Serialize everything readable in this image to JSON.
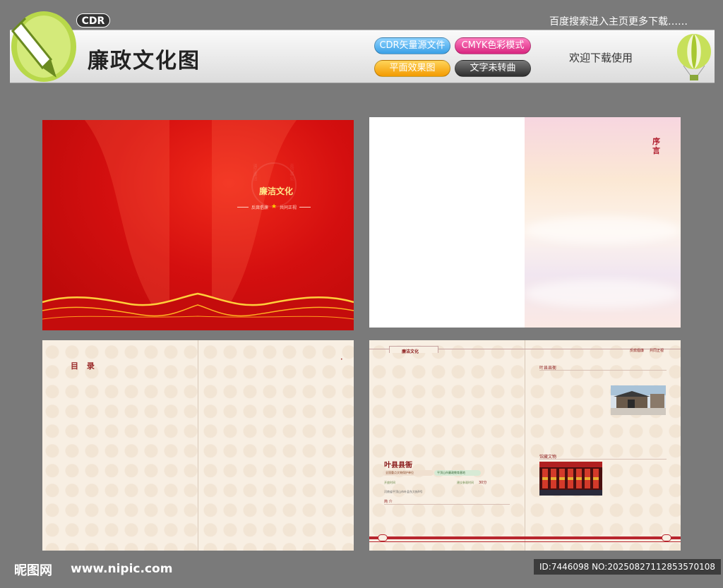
{
  "banner": {
    "cdr_tag": "CDR",
    "top_right": "百度搜索进入主页更多下载……",
    "title": "廉政文化图",
    "pills": {
      "cdr": "CDR矢量源文件",
      "cmyk": "CMYK色彩模式",
      "effect": "平面效果图",
      "text": "文字未转曲"
    },
    "welcome": "欢迎下载使用"
  },
  "cover": {
    "title": "廉洁文化",
    "left_sub": "反腐倡廉",
    "right_sub": "共同正视"
  },
  "preface": {
    "title": "序 言"
  },
  "toc": {
    "title": "目 录"
  },
  "spread": {
    "header_left": "廉洁文化",
    "header_right_1": "反腐倡廉",
    "header_right_2": "共同正视",
    "section1": "叶县县衙",
    "section2": "馆藏文物",
    "place_name": "叶县县衙",
    "chip1": "全国重点文物保护单位",
    "chip2": "平顶山市廉政教育基地",
    "label_open": "开放时间",
    "label_visit": "建议参观时间",
    "visit_value": "30分",
    "address": "河南省平顶山市叶县东大街9号",
    "intro": "简 介"
  },
  "footer": {
    "watermark": "昵图网",
    "url": "www.nipic.com",
    "id": "ID:7446098 NO:20250827112853570108"
  },
  "colors": {
    "red": "#d40f0f",
    "gold": "#ffd200",
    "background": "#7a7a7a"
  }
}
